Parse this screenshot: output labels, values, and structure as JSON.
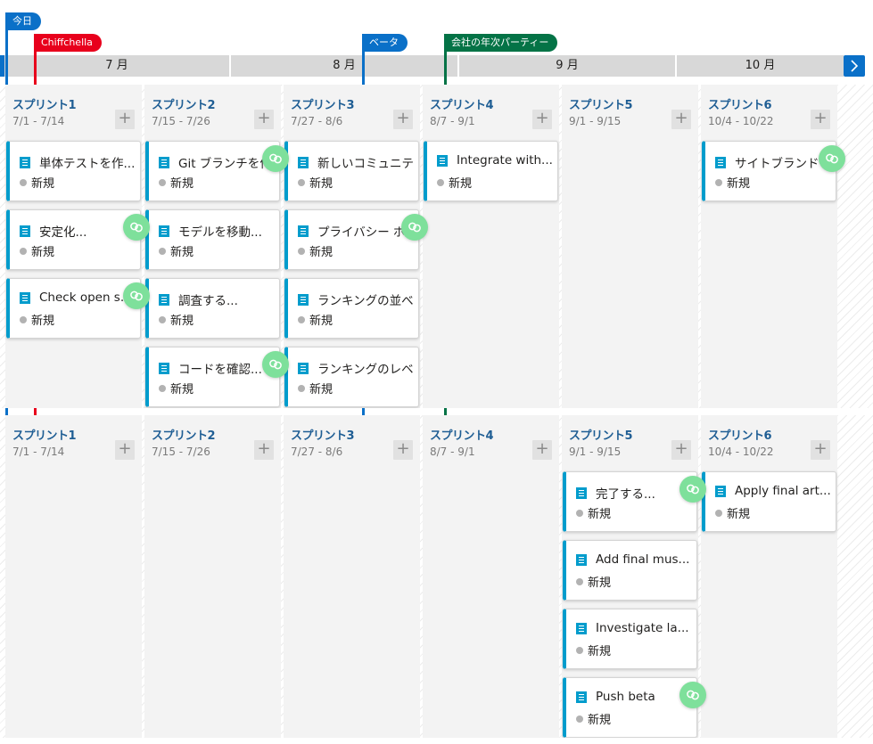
{
  "markers": [
    {
      "label": "今日",
      "color": "#0a70c8"
    },
    {
      "label": "Chiffchella",
      "color": "#e8001c"
    },
    {
      "label": "ベータ",
      "color": "#0a70c8"
    },
    {
      "label": "会社の年次パーティー",
      "color": "#047346"
    }
  ],
  "months": [
    "7 月",
    "8 月",
    "9 月",
    "10 月"
  ],
  "nav": {
    "next_icon": "chevron-right-icon"
  },
  "colors": {
    "accent": "#0a70c8",
    "card_bar": "#009ccc",
    "sprint_title": "#1f5e94",
    "link_badge": "#7ee09b",
    "state_new": "#b2b2b2"
  },
  "rows": [
    {
      "sprints": [
        {
          "name": "スプリント1",
          "dates": "7/1 - 7/14",
          "cards": [
            {
              "title": "単体テストを作...",
              "state": "新規",
              "linked": false
            },
            {
              "title": "安定化...",
              "state": "新規",
              "linked": true
            },
            {
              "title": "Check open s...",
              "state": "新規",
              "linked": true
            }
          ]
        },
        {
          "name": "スプリント2",
          "dates": "7/15 - 7/26",
          "cards": [
            {
              "title": "Git ブランチを作...",
              "state": "新規",
              "linked": true
            },
            {
              "title": "モデルを移動...",
              "state": "新規",
              "linked": false
            },
            {
              "title": "調査する...",
              "state": "新規",
              "linked": false
            },
            {
              "title": "コードを確認...",
              "state": "新規",
              "linked": true
            }
          ]
        },
        {
          "name": "スプリント3",
          "dates": "7/27 - 8/6",
          "cards": [
            {
              "title": "新しいコミュニテ...",
              "state": "新規",
              "linked": false
            },
            {
              "title": "プライバシー ポリ",
              "state": "新規",
              "linked": true
            },
            {
              "title": "ランキングの並べ",
              "state": "新規",
              "linked": false
            },
            {
              "title": "ランキングのレベル フ",
              "state": "新規",
              "linked": false
            }
          ]
        },
        {
          "name": "スプリント4",
          "dates": "8/7 - 9/1",
          "cards": [
            {
              "title": "Integrate with...",
              "state": "新規",
              "linked": false
            }
          ]
        },
        {
          "name": "スプリント5",
          "dates": "9/1 - 9/15",
          "cards": []
        },
        {
          "name": "スプリント6",
          "dates": "10/4 - 10/22",
          "cards": [
            {
              "title": "サイトブランドを...",
              "state": "新規",
              "linked": true
            }
          ]
        }
      ]
    },
    {
      "sprints": [
        {
          "name": "スプリント1",
          "dates": "7/1 - 7/14",
          "cards": []
        },
        {
          "name": "スプリント2",
          "dates": "7/15 - 7/26",
          "cards": []
        },
        {
          "name": "スプリント3",
          "dates": "7/27 - 8/6",
          "cards": []
        },
        {
          "name": "スプリント4",
          "dates": "8/7 - 9/1",
          "cards": []
        },
        {
          "name": "スプリント5",
          "dates": "9/1 - 9/15",
          "cards": [
            {
              "title": "完了する...",
              "state": "新規",
              "linked": true
            },
            {
              "title": "Add final mus...",
              "state": "新規",
              "linked": false
            },
            {
              "title": "Investigate la...",
              "state": "新規",
              "linked": false
            },
            {
              "title": "Push beta",
              "state": "新規",
              "linked": true
            }
          ]
        },
        {
          "name": "スプリント6",
          "dates": "10/4 - 10/22",
          "cards": [
            {
              "title": "Apply final art...",
              "state": "新規",
              "linked": false
            }
          ]
        }
      ]
    }
  ],
  "add_button_label": "+"
}
